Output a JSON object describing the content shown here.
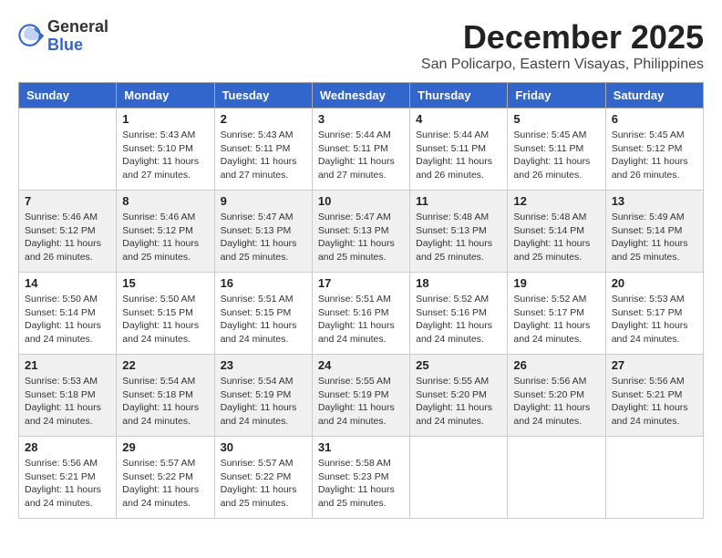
{
  "header": {
    "logo_line1": "General",
    "logo_line2": "Blue",
    "month_year": "December 2025",
    "location": "San Policarpo, Eastern Visayas, Philippines"
  },
  "weekdays": [
    "Sunday",
    "Monday",
    "Tuesday",
    "Wednesday",
    "Thursday",
    "Friday",
    "Saturday"
  ],
  "weeks": [
    [
      {
        "day": "",
        "sunrise": "",
        "sunset": "",
        "daylight": ""
      },
      {
        "day": "1",
        "sunrise": "Sunrise: 5:43 AM",
        "sunset": "Sunset: 5:10 PM",
        "daylight": "Daylight: 11 hours and 27 minutes."
      },
      {
        "day": "2",
        "sunrise": "Sunrise: 5:43 AM",
        "sunset": "Sunset: 5:11 PM",
        "daylight": "Daylight: 11 hours and 27 minutes."
      },
      {
        "day": "3",
        "sunrise": "Sunrise: 5:44 AM",
        "sunset": "Sunset: 5:11 PM",
        "daylight": "Daylight: 11 hours and 27 minutes."
      },
      {
        "day": "4",
        "sunrise": "Sunrise: 5:44 AM",
        "sunset": "Sunset: 5:11 PM",
        "daylight": "Daylight: 11 hours and 26 minutes."
      },
      {
        "day": "5",
        "sunrise": "Sunrise: 5:45 AM",
        "sunset": "Sunset: 5:11 PM",
        "daylight": "Daylight: 11 hours and 26 minutes."
      },
      {
        "day": "6",
        "sunrise": "Sunrise: 5:45 AM",
        "sunset": "Sunset: 5:12 PM",
        "daylight": "Daylight: 11 hours and 26 minutes."
      }
    ],
    [
      {
        "day": "7",
        "sunrise": "Sunrise: 5:46 AM",
        "sunset": "Sunset: 5:12 PM",
        "daylight": "Daylight: 11 hours and 26 minutes."
      },
      {
        "day": "8",
        "sunrise": "Sunrise: 5:46 AM",
        "sunset": "Sunset: 5:12 PM",
        "daylight": "Daylight: 11 hours and 25 minutes."
      },
      {
        "day": "9",
        "sunrise": "Sunrise: 5:47 AM",
        "sunset": "Sunset: 5:13 PM",
        "daylight": "Daylight: 11 hours and 25 minutes."
      },
      {
        "day": "10",
        "sunrise": "Sunrise: 5:47 AM",
        "sunset": "Sunset: 5:13 PM",
        "daylight": "Daylight: 11 hours and 25 minutes."
      },
      {
        "day": "11",
        "sunrise": "Sunrise: 5:48 AM",
        "sunset": "Sunset: 5:13 PM",
        "daylight": "Daylight: 11 hours and 25 minutes."
      },
      {
        "day": "12",
        "sunrise": "Sunrise: 5:48 AM",
        "sunset": "Sunset: 5:14 PM",
        "daylight": "Daylight: 11 hours and 25 minutes."
      },
      {
        "day": "13",
        "sunrise": "Sunrise: 5:49 AM",
        "sunset": "Sunset: 5:14 PM",
        "daylight": "Daylight: 11 hours and 25 minutes."
      }
    ],
    [
      {
        "day": "14",
        "sunrise": "Sunrise: 5:50 AM",
        "sunset": "Sunset: 5:14 PM",
        "daylight": "Daylight: 11 hours and 24 minutes."
      },
      {
        "day": "15",
        "sunrise": "Sunrise: 5:50 AM",
        "sunset": "Sunset: 5:15 PM",
        "daylight": "Daylight: 11 hours and 24 minutes."
      },
      {
        "day": "16",
        "sunrise": "Sunrise: 5:51 AM",
        "sunset": "Sunset: 5:15 PM",
        "daylight": "Daylight: 11 hours and 24 minutes."
      },
      {
        "day": "17",
        "sunrise": "Sunrise: 5:51 AM",
        "sunset": "Sunset: 5:16 PM",
        "daylight": "Daylight: 11 hours and 24 minutes."
      },
      {
        "day": "18",
        "sunrise": "Sunrise: 5:52 AM",
        "sunset": "Sunset: 5:16 PM",
        "daylight": "Daylight: 11 hours and 24 minutes."
      },
      {
        "day": "19",
        "sunrise": "Sunrise: 5:52 AM",
        "sunset": "Sunset: 5:17 PM",
        "daylight": "Daylight: 11 hours and 24 minutes."
      },
      {
        "day": "20",
        "sunrise": "Sunrise: 5:53 AM",
        "sunset": "Sunset: 5:17 PM",
        "daylight": "Daylight: 11 hours and 24 minutes."
      }
    ],
    [
      {
        "day": "21",
        "sunrise": "Sunrise: 5:53 AM",
        "sunset": "Sunset: 5:18 PM",
        "daylight": "Daylight: 11 hours and 24 minutes."
      },
      {
        "day": "22",
        "sunrise": "Sunrise: 5:54 AM",
        "sunset": "Sunset: 5:18 PM",
        "daylight": "Daylight: 11 hours and 24 minutes."
      },
      {
        "day": "23",
        "sunrise": "Sunrise: 5:54 AM",
        "sunset": "Sunset: 5:19 PM",
        "daylight": "Daylight: 11 hours and 24 minutes."
      },
      {
        "day": "24",
        "sunrise": "Sunrise: 5:55 AM",
        "sunset": "Sunset: 5:19 PM",
        "daylight": "Daylight: 11 hours and 24 minutes."
      },
      {
        "day": "25",
        "sunrise": "Sunrise: 5:55 AM",
        "sunset": "Sunset: 5:20 PM",
        "daylight": "Daylight: 11 hours and 24 minutes."
      },
      {
        "day": "26",
        "sunrise": "Sunrise: 5:56 AM",
        "sunset": "Sunset: 5:20 PM",
        "daylight": "Daylight: 11 hours and 24 minutes."
      },
      {
        "day": "27",
        "sunrise": "Sunrise: 5:56 AM",
        "sunset": "Sunset: 5:21 PM",
        "daylight": "Daylight: 11 hours and 24 minutes."
      }
    ],
    [
      {
        "day": "28",
        "sunrise": "Sunrise: 5:56 AM",
        "sunset": "Sunset: 5:21 PM",
        "daylight": "Daylight: 11 hours and 24 minutes."
      },
      {
        "day": "29",
        "sunrise": "Sunrise: 5:57 AM",
        "sunset": "Sunset: 5:22 PM",
        "daylight": "Daylight: 11 hours and 24 minutes."
      },
      {
        "day": "30",
        "sunrise": "Sunrise: 5:57 AM",
        "sunset": "Sunset: 5:22 PM",
        "daylight": "Daylight: 11 hours and 25 minutes."
      },
      {
        "day": "31",
        "sunrise": "Sunrise: 5:58 AM",
        "sunset": "Sunset: 5:23 PM",
        "daylight": "Daylight: 11 hours and 25 minutes."
      },
      {
        "day": "",
        "sunrise": "",
        "sunset": "",
        "daylight": ""
      },
      {
        "day": "",
        "sunrise": "",
        "sunset": "",
        "daylight": ""
      },
      {
        "day": "",
        "sunrise": "",
        "sunset": "",
        "daylight": ""
      }
    ]
  ]
}
